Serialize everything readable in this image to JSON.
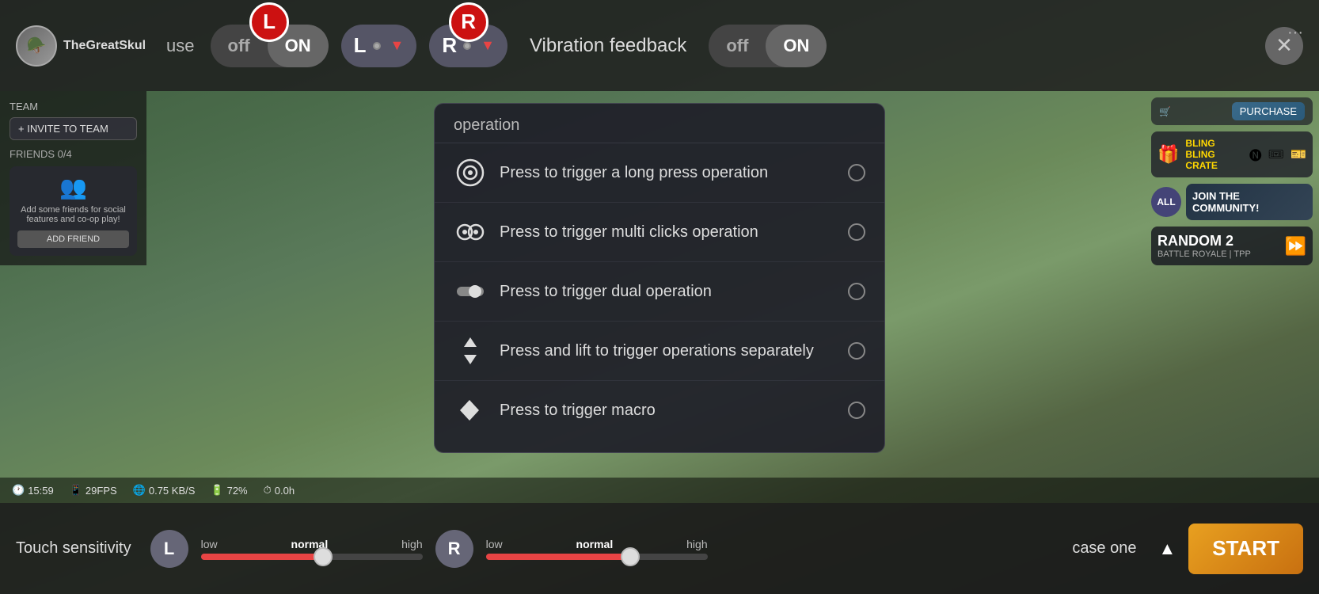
{
  "header": {
    "avatar_emoji": "🪖",
    "username": "TheGreatSkul",
    "use_label": "use",
    "toggle_off": "off",
    "toggle_on": "ON",
    "l_badge": "L",
    "r_badge": "R",
    "l_letter": "L",
    "r_letter": "R",
    "vibration_label": "Vibration feedback",
    "vib_off": "off",
    "vib_on": "ON",
    "close_icon": "✕",
    "three_dots": "···"
  },
  "left_sidebar": {
    "team_label": "TEAM",
    "invite_label": "+ INVITE TO TEAM",
    "friends_label": "FRIENDS 0/4",
    "friends_description": "Add some friends for social features and co-op play!",
    "add_friend_label": "ADD FRIEND"
  },
  "dropdown_menu": {
    "partial_header": "operation",
    "items": [
      {
        "id": "long-press",
        "text": "Press to trigger a long press operation",
        "selected": false
      },
      {
        "id": "multi-clicks",
        "text": "Press to trigger multi clicks operation",
        "selected": false
      },
      {
        "id": "dual",
        "text": "Press to trigger dual operation",
        "selected": false
      },
      {
        "id": "press-lift",
        "text": "Press and lift to trigger operations separately",
        "selected": false
      },
      {
        "id": "macro",
        "text": "Press to trigger macro",
        "selected": false
      }
    ]
  },
  "stats": {
    "time": "15:59",
    "fps": "29FPS",
    "network": "0.75 KB/S",
    "battery": "72%",
    "duration": "0.0h"
  },
  "bottom_toolbar": {
    "touch_sensitivity": "Touch sensitivity",
    "l_btn": "L",
    "r_btn": "R",
    "slider_l_low": "low",
    "slider_l_normal": "normal",
    "slider_l_high": "high",
    "slider_r_low": "low",
    "slider_r_normal": "normal",
    "slider_r_high": "high",
    "case_label": "case one",
    "start_label": "START"
  },
  "right_sidebar": {
    "purchase_label": "PURCHASE",
    "crate_title": "BLING BLING CRATE",
    "all_btn": "ALL",
    "community_text": "JOIN THE COMMUNITY!",
    "random_title": "RANDOM 2",
    "random_sub": "BATTLE ROYALE | TPP"
  },
  "colors": {
    "red": "#e84444",
    "gold": "#ffd700",
    "dark_bg": "rgba(30,30,40,0.92)"
  }
}
